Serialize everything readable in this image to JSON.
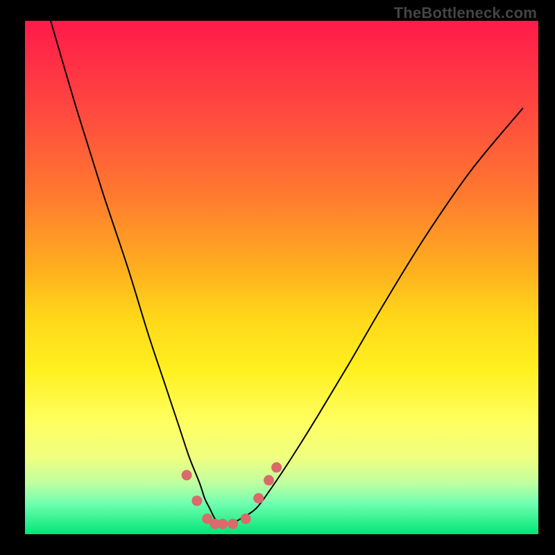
{
  "brand": "TheBottleneck.com",
  "colors": {
    "background": "#000000",
    "gradient_top": "#ff1a4a",
    "gradient_bottom": "#00e676",
    "curve": "#000000",
    "markers": "#db6a6a"
  },
  "chart_data": {
    "type": "line",
    "title": "",
    "xlabel": "",
    "ylabel": "",
    "xlim": [
      0,
      100
    ],
    "ylim": [
      0,
      100
    ],
    "grid": false,
    "legend": false,
    "x": [
      5,
      10,
      15,
      20,
      24,
      27,
      30,
      32,
      34,
      35,
      36,
      37,
      38,
      39,
      40,
      42,
      45,
      48,
      52,
      57,
      63,
      70,
      78,
      87,
      97
    ],
    "values": [
      100,
      83,
      67,
      52,
      39,
      30,
      21,
      15,
      10,
      7,
      5,
      3,
      2,
      2,
      2,
      3,
      5,
      9,
      15,
      23,
      33,
      45,
      58,
      71,
      83
    ],
    "annotations": [],
    "markers": [
      {
        "x": 31.5,
        "y": 11.5
      },
      {
        "x": 33.5,
        "y": 6.5
      },
      {
        "x": 35.5,
        "y": 3.0
      },
      {
        "x": 37.0,
        "y": 2.0
      },
      {
        "x": 38.5,
        "y": 2.0
      },
      {
        "x": 40.5,
        "y": 2.0
      },
      {
        "x": 43.0,
        "y": 3.0
      },
      {
        "x": 45.5,
        "y": 7.0
      },
      {
        "x": 47.5,
        "y": 10.5
      },
      {
        "x": 49.0,
        "y": 13.0
      }
    ]
  }
}
